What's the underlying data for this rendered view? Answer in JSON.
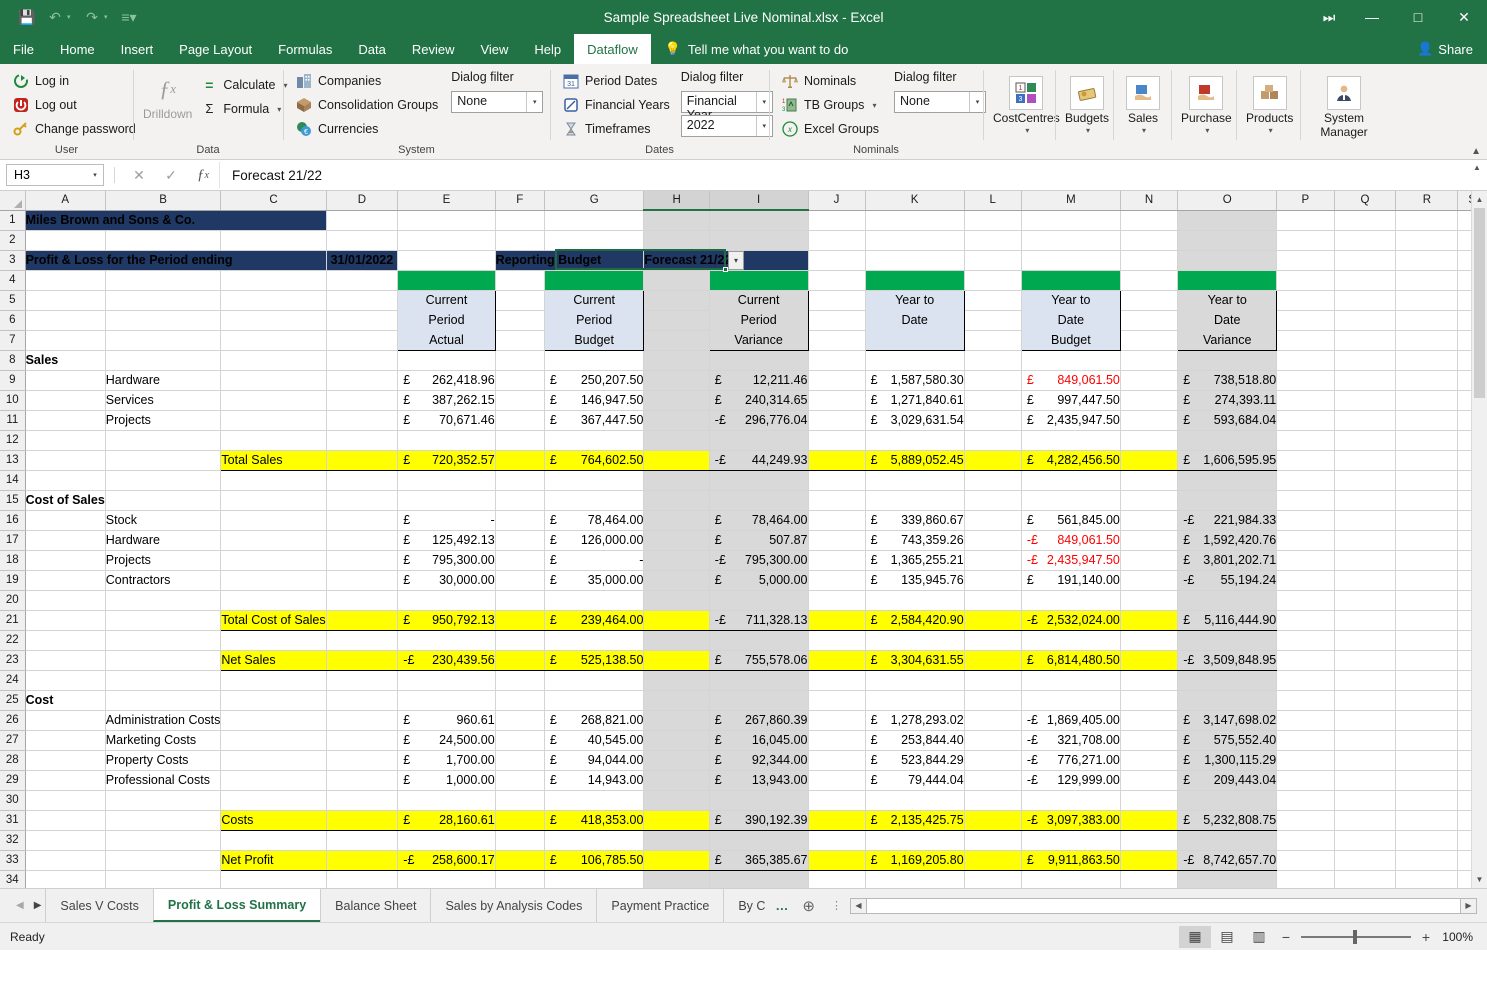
{
  "titlebar": {
    "document_title": "Sample Spreadsheet Live Nominal.xlsx  -  Excel",
    "qat": [
      {
        "name": "save",
        "glyph": "ὋE"
      },
      {
        "name": "undo",
        "glyph": "↶"
      },
      {
        "name": "redo",
        "glyph": "↷"
      },
      {
        "name": "customize",
        "glyph": "≡"
      }
    ],
    "window": {
      "ribbon_display_options": "⤓",
      "minimize": "—",
      "maximize": "□",
      "close": "✕"
    }
  },
  "ribbon_tabs": [
    {
      "label": "File",
      "active": false
    },
    {
      "label": "Home",
      "active": false
    },
    {
      "label": "Insert",
      "active": false
    },
    {
      "label": "Page Layout",
      "active": false
    },
    {
      "label": "Formulas",
      "active": false
    },
    {
      "label": "Data",
      "active": false
    },
    {
      "label": "Review",
      "active": false
    },
    {
      "label": "View",
      "active": false
    },
    {
      "label": "Help",
      "active": false
    },
    {
      "label": "Dataflow",
      "active": true
    }
  ],
  "tellme": {
    "label": "Tell me what you want to do",
    "icon": "lightbulb-icon"
  },
  "share": {
    "label": "Share",
    "icon": "share-person-icon"
  },
  "ribbon": {
    "groups": [
      {
        "title": "User",
        "items": [
          {
            "label": "Log in",
            "icon": "login-icon"
          },
          {
            "label": "Log out",
            "icon": "logout-icon"
          },
          {
            "label": "Change password",
            "icon": "key-icon"
          }
        ]
      },
      {
        "title": "Data",
        "big": {
          "label": "Drilldown",
          "icon": "fx-drilldown-icon"
        },
        "items": [
          {
            "label": "Calculate",
            "icon": "equals-icon",
            "caret": true
          },
          {
            "label": "Formula",
            "icon": "sigma-icon",
            "caret": true
          }
        ]
      },
      {
        "title": "System",
        "items": [
          {
            "label": "Companies",
            "icon": "companies-icon"
          },
          {
            "label": "Consolidation Groups",
            "icon": "consolidation-icon"
          },
          {
            "label": "Currencies",
            "icon": "currencies-icon"
          }
        ],
        "filter": {
          "label": "Dialog filter",
          "value": "None"
        }
      },
      {
        "title": "Dates",
        "items": [
          {
            "label": "Period Dates",
            "icon": "calendar-icon"
          },
          {
            "label": "Financial Years",
            "icon": "financial-year-icon"
          },
          {
            "label": "Timeframes",
            "icon": "hourglass-icon"
          }
        ],
        "filter": {
          "label": "Dialog filter",
          "value": "Financial Year",
          "value2": "2022"
        }
      },
      {
        "title": "Nominals",
        "items": [
          {
            "label": "Nominals",
            "icon": "scales-icon"
          },
          {
            "label": "TB Groups",
            "icon": "tb-groups-icon",
            "caret": true
          },
          {
            "label": "Excel Groups",
            "icon": "excel-groups-icon"
          }
        ],
        "filter": {
          "label": "Dialog filter",
          "value": "None"
        }
      }
    ],
    "buttons": [
      {
        "label": "CostCentres",
        "icon": "costcentres-icon",
        "caret": true
      },
      {
        "label": "Budgets",
        "icon": "budgets-icon",
        "caret": true
      },
      {
        "label": "Sales",
        "icon": "sales-icon",
        "caret": true
      },
      {
        "label": "Purchase",
        "icon": "purchase-icon",
        "caret": true
      },
      {
        "label": "Products",
        "icon": "products-icon",
        "caret": true
      },
      {
        "label": "System Manager",
        "icon": "system-manager-icon",
        "caret": true
      }
    ]
  },
  "formula_bar": {
    "name_box": "H3",
    "cancel_icon": "✕",
    "enter_icon": "✓",
    "function_icon": "fx",
    "value": "Forecast 21/22"
  },
  "grid": {
    "columns": [
      "A",
      "B",
      "C",
      "D",
      "E",
      "F",
      "G",
      "H",
      "I",
      "J",
      "K",
      "L",
      "M",
      "N",
      "O",
      "P",
      "Q",
      "R",
      "S"
    ],
    "selected_columns": [
      "H",
      "I"
    ],
    "selected_cell": "H3",
    "rows": [
      1,
      2,
      3,
      4,
      5,
      6,
      7,
      8,
      9,
      10,
      11,
      12,
      13,
      14,
      15,
      16,
      17,
      18,
      19,
      20,
      21,
      22,
      23,
      24,
      25,
      26,
      27,
      28,
      29,
      30,
      31,
      32,
      33,
      34
    ],
    "cells": {
      "company_name": "Miles Brown and Sons & Co.",
      "report_title": "Profit & Loss for the Period ending",
      "report_date": "31/01/2022",
      "reporting_budget_label": "Reporting Budget",
      "forecast_label": "Forecast 21/22"
    },
    "column_headers": [
      {
        "col": "E",
        "lines": [
          "Current",
          "Period",
          "Actual"
        ],
        "style": "blue"
      },
      {
        "col": "G",
        "lines": [
          "Current",
          "Period",
          "Budget"
        ],
        "style": "blue"
      },
      {
        "col": "I",
        "lines": [
          "Current",
          "Period",
          "Variance"
        ],
        "style": "grey"
      },
      {
        "col": "K",
        "lines": [
          "Year to",
          "Date",
          ""
        ],
        "style": "blue"
      },
      {
        "col": "M",
        "lines": [
          "Year to",
          "Date",
          "Budget"
        ],
        "style": "blue"
      },
      {
        "col": "O",
        "lines": [
          "Year to",
          "Date",
          "Variance"
        ],
        "style": "grey"
      }
    ],
    "sections": [
      {
        "row": 8,
        "title": "Sales"
      },
      {
        "row": 15,
        "title": "Cost of Sales"
      },
      {
        "row": 25,
        "title": "Cost"
      }
    ],
    "data_rows": [
      {
        "row": 9,
        "label": "Hardware",
        "E": {
          "cur": "£",
          "v": "262,418.96"
        },
        "G": {
          "cur": "£",
          "v": "250,207.50"
        },
        "I": {
          "cur": "£",
          "v": "12,211.46"
        },
        "K": {
          "cur": "£",
          "v": "1,587,580.30"
        },
        "M": {
          "cur": "£",
          "v": "849,061.50",
          "red": true
        },
        "O": {
          "cur": "£",
          "v": "738,518.80"
        }
      },
      {
        "row": 10,
        "label": "Services",
        "E": {
          "cur": "£",
          "v": "387,262.15"
        },
        "G": {
          "cur": "£",
          "v": "146,947.50"
        },
        "I": {
          "cur": "£",
          "v": "240,314.65"
        },
        "K": {
          "cur": "£",
          "v": "1,271,840.61"
        },
        "M": {
          "cur": "£",
          "v": "997,447.50"
        },
        "O": {
          "cur": "£",
          "v": "274,393.11"
        }
      },
      {
        "row": 11,
        "label": "Projects",
        "E": {
          "cur": "£",
          "v": "70,671.46"
        },
        "G": {
          "cur": "£",
          "v": "367,447.50"
        },
        "I": {
          "cur": "-£",
          "v": "296,776.04"
        },
        "K": {
          "cur": "£",
          "v": "3,029,631.54"
        },
        "M": {
          "cur": "£",
          "v": "2,435,947.50"
        },
        "O": {
          "cur": "£",
          "v": "593,684.04"
        }
      },
      {
        "row": 16,
        "label": "Stock",
        "E": {
          "cur": "£",
          "v": "-"
        },
        "G": {
          "cur": "£",
          "v": "78,464.00"
        },
        "I": {
          "cur": "£",
          "v": "78,464.00"
        },
        "K": {
          "cur": "£",
          "v": "339,860.67"
        },
        "M": {
          "cur": "£",
          "v": "561,845.00"
        },
        "O": {
          "cur": "-£",
          "v": "221,984.33"
        }
      },
      {
        "row": 17,
        "label": "Hardware",
        "E": {
          "cur": "£",
          "v": "125,492.13"
        },
        "G": {
          "cur": "£",
          "v": "126,000.00"
        },
        "I": {
          "cur": "£",
          "v": "507.87"
        },
        "K": {
          "cur": "£",
          "v": "743,359.26"
        },
        "M": {
          "cur": "-£",
          "v": "849,061.50",
          "red": true
        },
        "O": {
          "cur": "£",
          "v": "1,592,420.76"
        }
      },
      {
        "row": 18,
        "label": "Projects",
        "E": {
          "cur": "£",
          "v": "795,300.00"
        },
        "G": {
          "cur": "£",
          "v": "-"
        },
        "I": {
          "cur": "-£",
          "v": "795,300.00"
        },
        "K": {
          "cur": "£",
          "v": "1,365,255.21"
        },
        "M": {
          "cur": "-£",
          "v": "2,435,947.50",
          "red": true
        },
        "O": {
          "cur": "£",
          "v": "3,801,202.71"
        }
      },
      {
        "row": 19,
        "label": "Contractors",
        "E": {
          "cur": "£",
          "v": "30,000.00"
        },
        "G": {
          "cur": "£",
          "v": "35,000.00"
        },
        "I": {
          "cur": "£",
          "v": "5,000.00"
        },
        "K": {
          "cur": "£",
          "v": "135,945.76"
        },
        "M": {
          "cur": "£",
          "v": "191,140.00"
        },
        "O": {
          "cur": "-£",
          "v": "55,194.24"
        }
      },
      {
        "row": 26,
        "label": "Administration Costs",
        "E": {
          "cur": "£",
          "v": "960.61"
        },
        "G": {
          "cur": "£",
          "v": "268,821.00"
        },
        "I": {
          "cur": "£",
          "v": "267,860.39"
        },
        "K": {
          "cur": "£",
          "v": "1,278,293.02"
        },
        "M": {
          "cur": "-£",
          "v": "1,869,405.00"
        },
        "O": {
          "cur": "£",
          "v": "3,147,698.02"
        }
      },
      {
        "row": 27,
        "label": "Marketing Costs",
        "E": {
          "cur": "£",
          "v": "24,500.00"
        },
        "G": {
          "cur": "£",
          "v": "40,545.00"
        },
        "I": {
          "cur": "£",
          "v": "16,045.00"
        },
        "K": {
          "cur": "£",
          "v": "253,844.40"
        },
        "M": {
          "cur": "-£",
          "v": "321,708.00"
        },
        "O": {
          "cur": "£",
          "v": "575,552.40"
        }
      },
      {
        "row": 28,
        "label": "Property Costs",
        "E": {
          "cur": "£",
          "v": "1,700.00"
        },
        "G": {
          "cur": "£",
          "v": "94,044.00"
        },
        "I": {
          "cur": "£",
          "v": "92,344.00"
        },
        "K": {
          "cur": "£",
          "v": "523,844.29"
        },
        "M": {
          "cur": "-£",
          "v": "776,271.00"
        },
        "O": {
          "cur": "£",
          "v": "1,300,115.29"
        }
      },
      {
        "row": 29,
        "label": "Professional Costs",
        "E": {
          "cur": "£",
          "v": "1,000.00"
        },
        "G": {
          "cur": "£",
          "v": "14,943.00"
        },
        "I": {
          "cur": "£",
          "v": "13,943.00"
        },
        "K": {
          "cur": "£",
          "v": "79,444.04"
        },
        "M": {
          "cur": "-£",
          "v": "129,999.00"
        },
        "O": {
          "cur": "£",
          "v": "209,443.04"
        }
      }
    ],
    "total_rows": [
      {
        "row": 13,
        "label": "Total Sales",
        "E": {
          "cur": "£",
          "v": "720,352.57"
        },
        "G": {
          "cur": "£",
          "v": "764,602.50"
        },
        "I": {
          "cur": "-£",
          "v": "44,249.93"
        },
        "K": {
          "cur": "£",
          "v": "5,889,052.45"
        },
        "M": {
          "cur": "£",
          "v": "4,282,456.50"
        },
        "O": {
          "cur": "£",
          "v": "1,606,595.95"
        }
      },
      {
        "row": 21,
        "label": "Total Cost of Sales",
        "E": {
          "cur": "£",
          "v": "950,792.13"
        },
        "G": {
          "cur": "£",
          "v": "239,464.00"
        },
        "I": {
          "cur": "-£",
          "v": "711,328.13"
        },
        "K": {
          "cur": "£",
          "v": "2,584,420.90"
        },
        "M": {
          "cur": "-£",
          "v": "2,532,024.00"
        },
        "O": {
          "cur": "£",
          "v": "5,116,444.90"
        }
      },
      {
        "row": 23,
        "label": "Net Sales",
        "E": {
          "cur": "-£",
          "v": "230,439.56"
        },
        "G": {
          "cur": "£",
          "v": "525,138.50"
        },
        "I": {
          "cur": "£",
          "v": "755,578.06"
        },
        "K": {
          "cur": "£",
          "v": "3,304,631.55"
        },
        "M": {
          "cur": "£",
          "v": "6,814,480.50"
        },
        "O": {
          "cur": "-£",
          "v": "3,509,848.95"
        }
      },
      {
        "row": 31,
        "label": "Costs",
        "E": {
          "cur": "£",
          "v": "28,160.61"
        },
        "G": {
          "cur": "£",
          "v": "418,353.00"
        },
        "I": {
          "cur": "£",
          "v": "390,192.39"
        },
        "K": {
          "cur": "£",
          "v": "2,135,425.75"
        },
        "M": {
          "cur": "-£",
          "v": "3,097,383.00"
        },
        "O": {
          "cur": "£",
          "v": "5,232,808.75"
        }
      },
      {
        "row": 33,
        "label": "Net Profit",
        "E": {
          "cur": "-£",
          "v": "258,600.17"
        },
        "G": {
          "cur": "£",
          "v": "106,785.50"
        },
        "I": {
          "cur": "£",
          "v": "365,385.67"
        },
        "K": {
          "cur": "£",
          "v": "1,169,205.80"
        },
        "M": {
          "cur": "£",
          "v": "9,911,863.50"
        },
        "O": {
          "cur": "-£",
          "v": "8,742,657.70"
        }
      }
    ]
  },
  "sheet_tabs": {
    "tabs": [
      {
        "label": "Sales V Costs",
        "active": false
      },
      {
        "label": "Profit & Loss Summary",
        "active": true
      },
      {
        "label": "Balance Sheet",
        "active": false
      },
      {
        "label": "Sales by Analysis Codes",
        "active": false
      },
      {
        "label": "Payment Practice",
        "active": false
      },
      {
        "label": "By C",
        "active": false
      }
    ],
    "overflow": "…",
    "add_sheet": "⊕"
  },
  "statusbar": {
    "status": "Ready",
    "views": [
      {
        "name": "normal-view",
        "glyph": "▦",
        "active": true
      },
      {
        "name": "page-layout-view",
        "glyph": "▤",
        "active": false
      },
      {
        "name": "page-break-view",
        "glyph": "▥",
        "active": false
      }
    ],
    "zoom_out": "−",
    "zoom_in": "+",
    "zoom_level": "100%"
  }
}
